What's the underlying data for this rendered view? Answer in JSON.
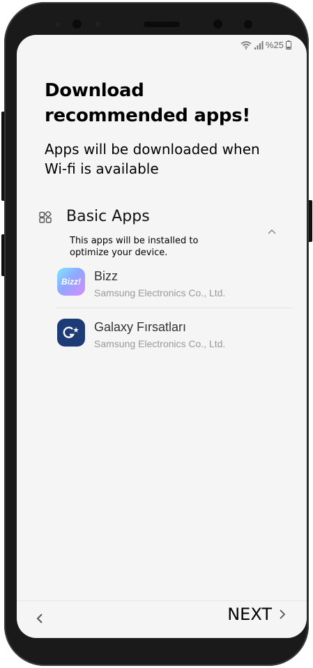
{
  "status_bar": {
    "battery": "%25"
  },
  "page": {
    "title": "Download recommended apps!",
    "subtitle": "Apps will be downloaded when Wi-fi is available"
  },
  "section": {
    "title": "Basic Apps",
    "description": "This apps will be installed to optimize your device."
  },
  "apps": [
    {
      "name": "Bizz",
      "developer": "Samsung Electronics Co., Ltd.",
      "icon": "bizz-app-icon",
      "icon_text": "Bizz!"
    },
    {
      "name": "Galaxy Fırsatları",
      "developer": "Samsung Electronics Co., Ltd.",
      "icon": "galaxy-firsatlari-app-icon"
    }
  ],
  "footer": {
    "next_label": "NEXT"
  },
  "colors": {
    "screen_bg": "#f6f5f6",
    "phone_body": "#1a1a1a",
    "galaxy_icon_bg": "#1d3b77"
  }
}
